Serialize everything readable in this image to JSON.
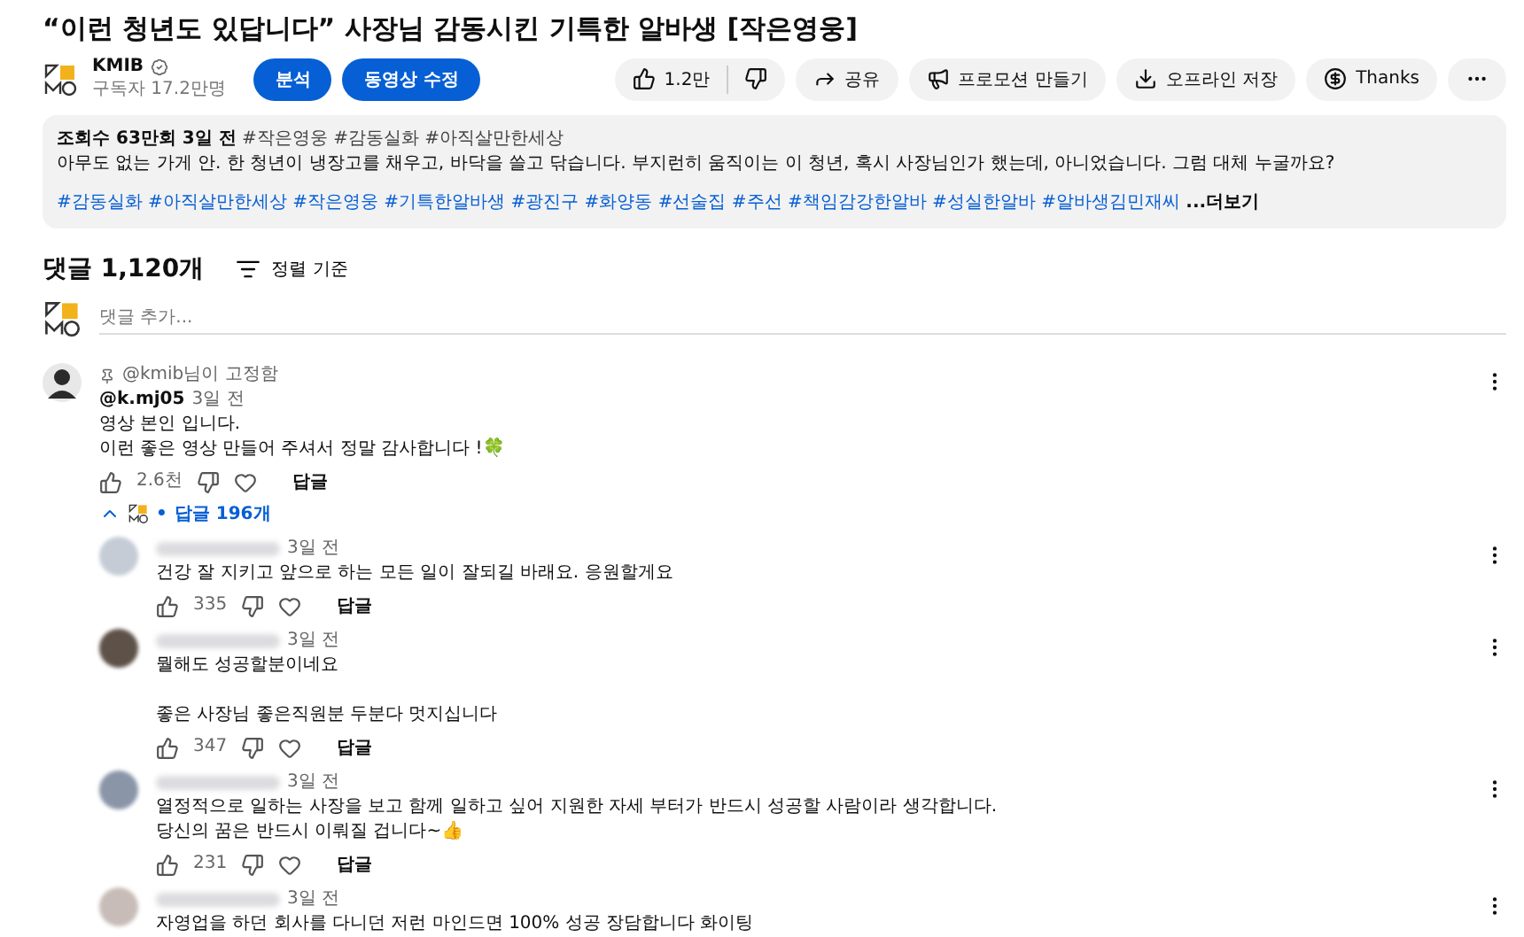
{
  "title": "“이런 청년도 있답니다” 사장님 감동시킨 기특한 알바생 [작은영웅]",
  "channel": {
    "name": "KMIB",
    "verified": true,
    "subscribers": "구독자 17.2만명"
  },
  "channel_buttons": [
    "분석",
    "동영상 수정"
  ],
  "actions": [
    {
      "kind": "like",
      "label": "1.2만"
    },
    {
      "kind": "share",
      "label": "공유"
    },
    {
      "kind": "promo",
      "label": "프로모션 만들기"
    },
    {
      "kind": "download",
      "label": "오프라인 저장"
    },
    {
      "kind": "thanks",
      "label": "Thanks"
    },
    {
      "kind": "more"
    }
  ],
  "description": {
    "stats": "조회수 63만회  3일 전",
    "top_tags": "#작은영웅 #감동실화 #아직살만한세상",
    "text": "아무도 없는 가게 안. 한 청년이 냉장고를 채우고, 바닥을 쓸고 닦습니다. 부지런히 움직이는 이 청년, 혹시 사장님인가 했는데, 아니었습니다. 그럼 대체 누굴까요?",
    "tags": "#감동실화 #아직살만한세상 #작은영웅 #기특한알바생 #광진구 #화양동 #선술집 #주선 #책임감강한알바 #성실한알바 #알바생김민재씨",
    "more": "...더보기"
  },
  "comments": {
    "count": "댓글 1,120개",
    "sort": "정렬 기준",
    "placeholder": "댓글 추가..."
  },
  "pinned": {
    "pinned_by": "@kmib님이 고정함",
    "author": "@k.mj05",
    "time": "3일 전",
    "lines": [
      "영상 본인 입니다.",
      "이런 좋은 영상 만들어 주셔서 정말 감사합니다 !🍀"
    ],
    "likes": "2.6천",
    "reply": "답글",
    "separator": "•",
    "replies_label": "답글 196개",
    "expanded": true
  },
  "replies": [
    {
      "color": "#c5ccd6",
      "time": "3일 전",
      "paragraphs": [
        [
          "건강 잘 지키고 앞으로 하는 모든 일이 잘되길 바래요. 응원할게요"
        ]
      ],
      "likes": "335",
      "reply": "답글"
    },
    {
      "color": "#5e5248",
      "time": "3일 전",
      "paragraphs": [
        [
          "뭘해도 성공할분이네요"
        ],
        [
          "좋은 사장님 좋은직원분 두분다 멋지십니다"
        ]
      ],
      "likes": "347",
      "reply": "답글"
    },
    {
      "color": "#8a96a8",
      "time": "3일 전",
      "paragraphs": [
        [
          "열정적으로 일하는 사장을 보고 함께 일하고 싶어 지원한 자세 부터가 반드시 성공할 사람이라 생각합니다.",
          "당신의 꿈은 반드시 이뤄질 겁니다~👍"
        ]
      ],
      "likes": "231",
      "reply": "답글"
    },
    {
      "color": "#c8bcb8",
      "time": "3일 전",
      "paragraphs": [
        [
          "자영업을 하던 회사를 다니던 저런 마인드면 100% 성공 장담합니다 화이팅"
        ]
      ]
    }
  ]
}
